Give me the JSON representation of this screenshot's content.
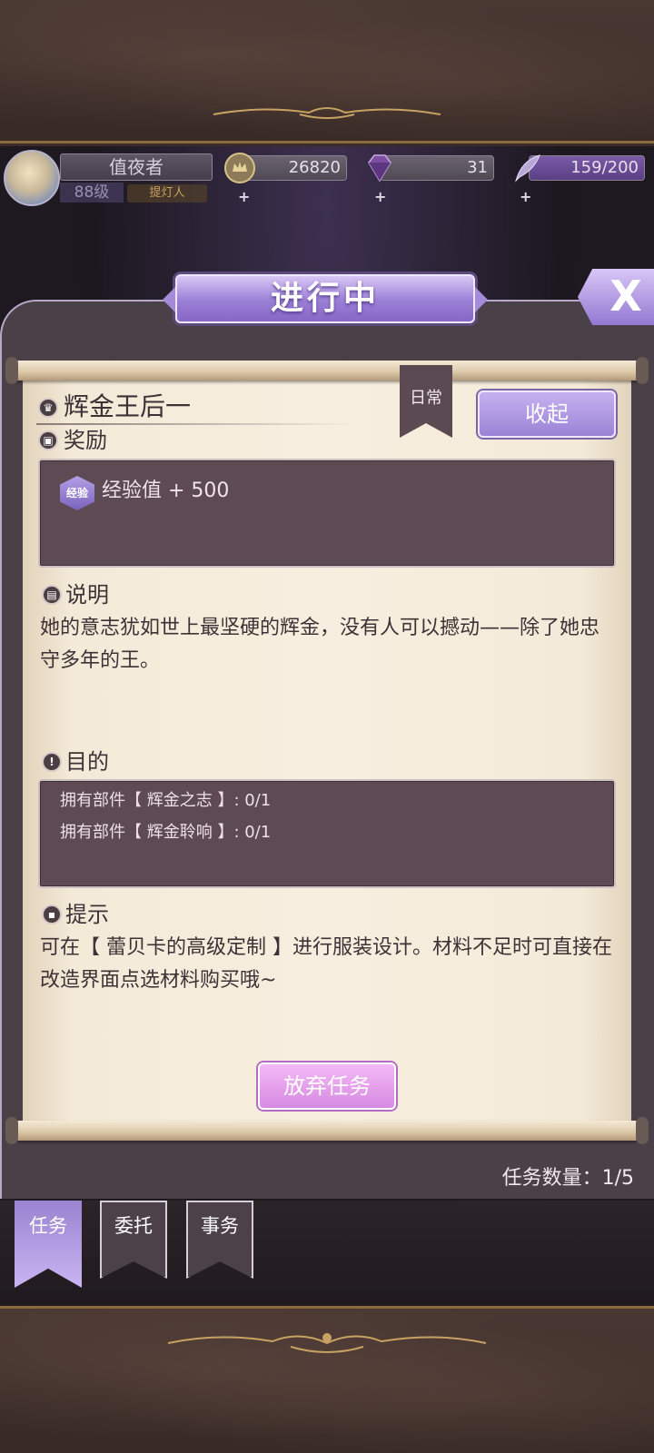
{
  "player": {
    "name": "值夜者",
    "level": "88级",
    "title_badge": "提灯人"
  },
  "resources": {
    "gold": "26820",
    "gems": "31",
    "stamina": "159/200"
  },
  "header": {
    "title": "进行中",
    "close_label": "X"
  },
  "quest": {
    "title": "辉金王后一",
    "category_tag": "日常",
    "collapse_button": "收起",
    "reward_section": "奖励",
    "reward_icon_label": "经验",
    "reward_text": "经验值 + 500",
    "description_section": "说明",
    "description_text": "她的意志犹如世上最坚硬的辉金，没有人可以撼动——除了她忠守多年的王。",
    "goal_section": "目的",
    "goals": [
      "拥有部件【 辉金之志 】: 0/1",
      "拥有部件【 辉金聆响 】: 0/1"
    ],
    "hint_section": "提示",
    "hint_text": "可在【 蕾贝卡的高级定制 】进行服装设计。材料不足时可直接在改造界面点选材料购买哦~",
    "abandon_button": "放弃任务"
  },
  "task_count": "任务数量：1/5",
  "tabs": [
    {
      "label": "任务",
      "active": true
    },
    {
      "label": "委托",
      "active": false
    },
    {
      "label": "事务",
      "active": false
    }
  ],
  "colors": {
    "accent_purple": "#9a83d0",
    "abandon_pink": "#d78ae2",
    "paper": "#f7eedf",
    "dark_box": "#5d4a52"
  }
}
